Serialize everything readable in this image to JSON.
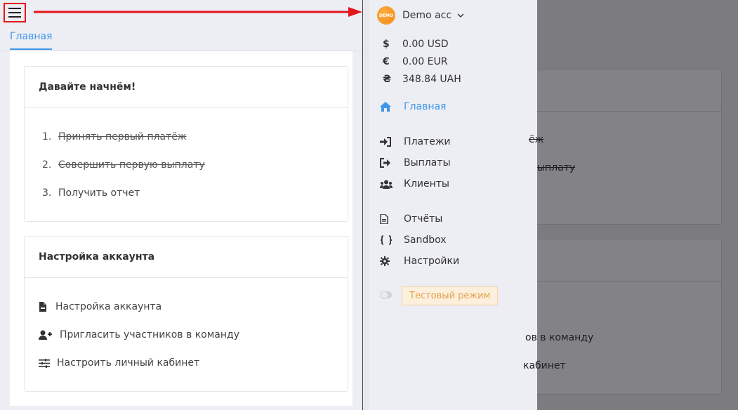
{
  "left": {
    "tab_home": "Главная",
    "getting_started": {
      "title": "Давайте начнём!",
      "steps": [
        {
          "num": "1.",
          "label": "Принять первый платёж"
        },
        {
          "num": "2.",
          "label": "Совершить первую выплату"
        },
        {
          "num": "3.",
          "label": "Получить отчет"
        }
      ]
    },
    "account_setup": {
      "title": "Настройка аккаунта",
      "items": [
        {
          "icon": "file-icon",
          "label": "Настройка аккаунта"
        },
        {
          "icon": "user-plus-icon",
          "label": "Пригласить участников в команду"
        },
        {
          "icon": "sliders-icon",
          "label": "Настроить личный кабинет"
        }
      ]
    }
  },
  "drawer": {
    "badge_text": "DEMO",
    "account_name": "Demo acc",
    "balances": [
      {
        "symbol": "$",
        "amount": "0.00 USD"
      },
      {
        "symbol": "€",
        "amount": "0.00 EUR"
      },
      {
        "symbol": "₴",
        "amount": "348.84 UAH"
      }
    ],
    "nav": {
      "home": "Главная",
      "payments": "Платежи",
      "payouts": "Выплаты",
      "clients": "Клиенты",
      "reports": "Отчёты",
      "sandbox": "Sandbox",
      "settings": "Настройки"
    },
    "test_mode": "Тестовый режим"
  },
  "overlay": {
    "step1_tail": "ёж",
    "step2_tail": "ыплату",
    "invite_tail": "ов в команду",
    "cabinet_tail": "кабинет"
  },
  "colors": {
    "accent": "#3f97e8",
    "annotation_red": "#e3161a",
    "test_badge_bg": "#fcefdc",
    "test_badge_text": "#e3a04f"
  }
}
